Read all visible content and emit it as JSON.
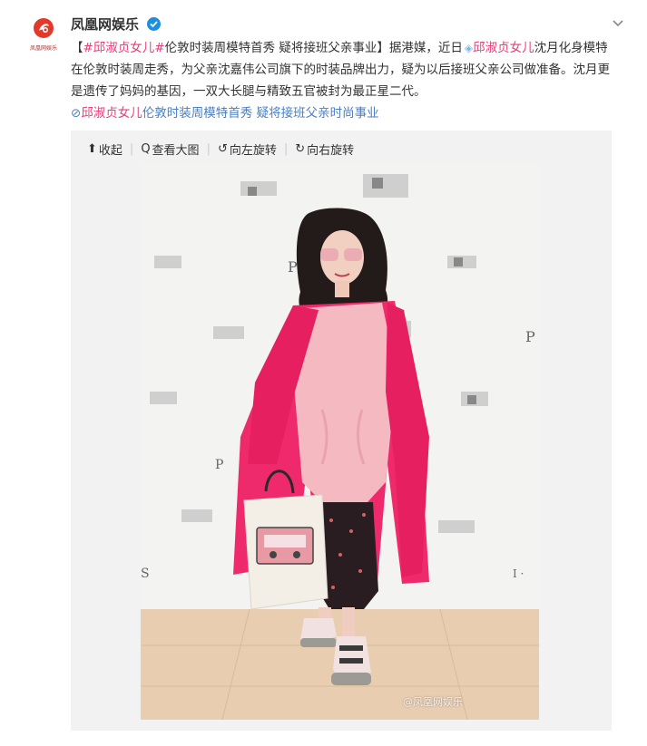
{
  "account": {
    "name": "凤凰网娱乐",
    "logo_subtext": "凤凰网娱乐",
    "verified_icon": "verified-badge-icon"
  },
  "post": {
    "segments": [
      {
        "text": "【",
        "style": "plain"
      },
      {
        "text": "#邱淑贞女儿#",
        "style": "hl"
      },
      {
        "text": "伦敦时装周模特首秀 疑将接班父亲事业】据港媒，近日",
        "style": "plain"
      },
      {
        "text": "◈",
        "style": "diamond"
      },
      {
        "text": "邱淑贞女儿",
        "style": "hl"
      },
      {
        "text": "沈月化身模特在伦敦时装周走秀，为父亲沈嘉伟公司旗下的时装品牌出力，疑为以后接班父亲公司做准备。沈月更是遗传了妈妈的基因，一双大长腿与精致五官被封为最正星二代。",
        "style": "plain"
      },
      {
        "text": "",
        "style": "break"
      },
      {
        "text": "⊘",
        "style": "lk"
      },
      {
        "text": "邱淑贞女儿",
        "style": "hl"
      },
      {
        "text": "伦敦时装周模特首秀 疑将接班父亲时尚事业",
        "style": "lk"
      }
    ]
  },
  "toolbar": {
    "collapse": "收起",
    "view_large": "查看大图",
    "rotate_left": "向左旋转",
    "rotate_right": "向右旋转"
  },
  "photo": {
    "watermark": "@凤凰网娱乐"
  },
  "colors": {
    "hashtag": "#eb3c78",
    "link": "#4a7fc4",
    "coat": "#ef2a6c",
    "sweater": "#f5b9c2"
  }
}
